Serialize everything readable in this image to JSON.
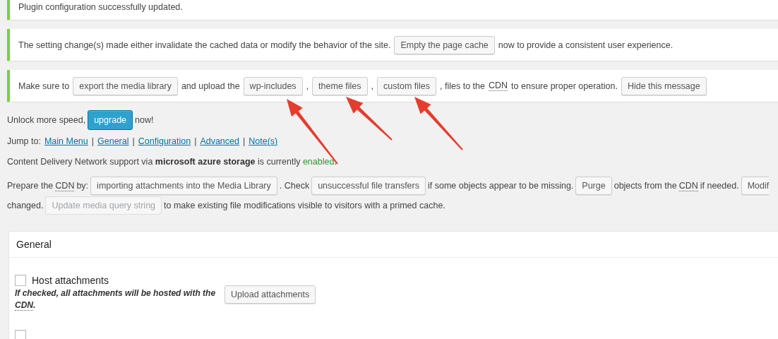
{
  "notices": [
    {
      "parts": [
        {
          "kind": "text",
          "text": "Plugin configuration successfully updated."
        }
      ]
    },
    {
      "parts": [
        {
          "kind": "text",
          "text": "The setting change(s) made either invalidate the cached data or modify the behavior of the site."
        },
        {
          "kind": "button",
          "text": "Empty the page cache"
        },
        {
          "kind": "text",
          "text": "now to provide a consistent user experience."
        }
      ]
    },
    {
      "parts": [
        {
          "kind": "text",
          "text": "Make sure to"
        },
        {
          "kind": "button",
          "text": "export the media library"
        },
        {
          "kind": "text",
          "text": "and upload the"
        },
        {
          "kind": "button",
          "text": "wp-includes"
        },
        {
          "kind": "text",
          "text": ","
        },
        {
          "kind": "button",
          "text": "theme files"
        },
        {
          "kind": "text",
          "text": ","
        },
        {
          "kind": "button",
          "text": "custom files"
        },
        {
          "kind": "text",
          "text": ", files to the"
        },
        {
          "kind": "abbr",
          "text": "CDN"
        },
        {
          "kind": "text",
          "text": "to ensure proper operation."
        },
        {
          "kind": "button",
          "text": "Hide this message"
        }
      ]
    }
  ],
  "upgrade_line": [
    {
      "kind": "text",
      "text": "Unlock more speed,"
    },
    {
      "kind": "primary_button",
      "text": "upgrade"
    },
    {
      "kind": "text",
      "text": "now!"
    }
  ],
  "jump_to": {
    "label": "Jump to:",
    "separator": "|",
    "links": [
      "Main Menu",
      "General",
      "Configuration",
      "Advanced",
      "Note(s)"
    ]
  },
  "status_line": {
    "text": "Content Delivery Network support via **microsoft azure storage** is currently",
    "state": "enabled",
    "enabled": true,
    "end": "."
  },
  "prepare_lines": [
    [
      {
        "kind": "text",
        "text": "Prepare the"
      },
      {
        "kind": "abbr",
        "text": "CDN"
      },
      {
        "kind": "text",
        "text": "by:"
      },
      {
        "kind": "button",
        "text": "importing attachments into the Media Library"
      },
      {
        "kind": "text",
        "text": ". Check"
      },
      {
        "kind": "button",
        "text": "unsuccessful file transfers"
      },
      {
        "kind": "text",
        "text": "if some objects appear to be missing."
      },
      {
        "kind": "button",
        "text": "Purge"
      },
      {
        "kind": "text",
        "text": "objects from the"
      },
      {
        "kind": "abbr",
        "text": "CDN"
      },
      {
        "kind": "text",
        "text": "if needed."
      },
      {
        "kind": "cut_button",
        "text": "Modif"
      }
    ],
    [
      {
        "kind": "text",
        "text": "changed."
      },
      {
        "kind": "disabled_button",
        "text": "Update media query string"
      },
      {
        "kind": "text",
        "text": "to make existing file modifications visible to visitors with a primed cache."
      }
    ]
  ],
  "general": {
    "title": "General",
    "options": [
      {
        "label": "Host attachments",
        "checked": false,
        "description": "If checked, all attachments will be hosted with the",
        "description_abbr": "CDN",
        "description_end": ".",
        "button": "Upload attachments"
      },
      {
        "checked": false
      }
    ]
  }
}
